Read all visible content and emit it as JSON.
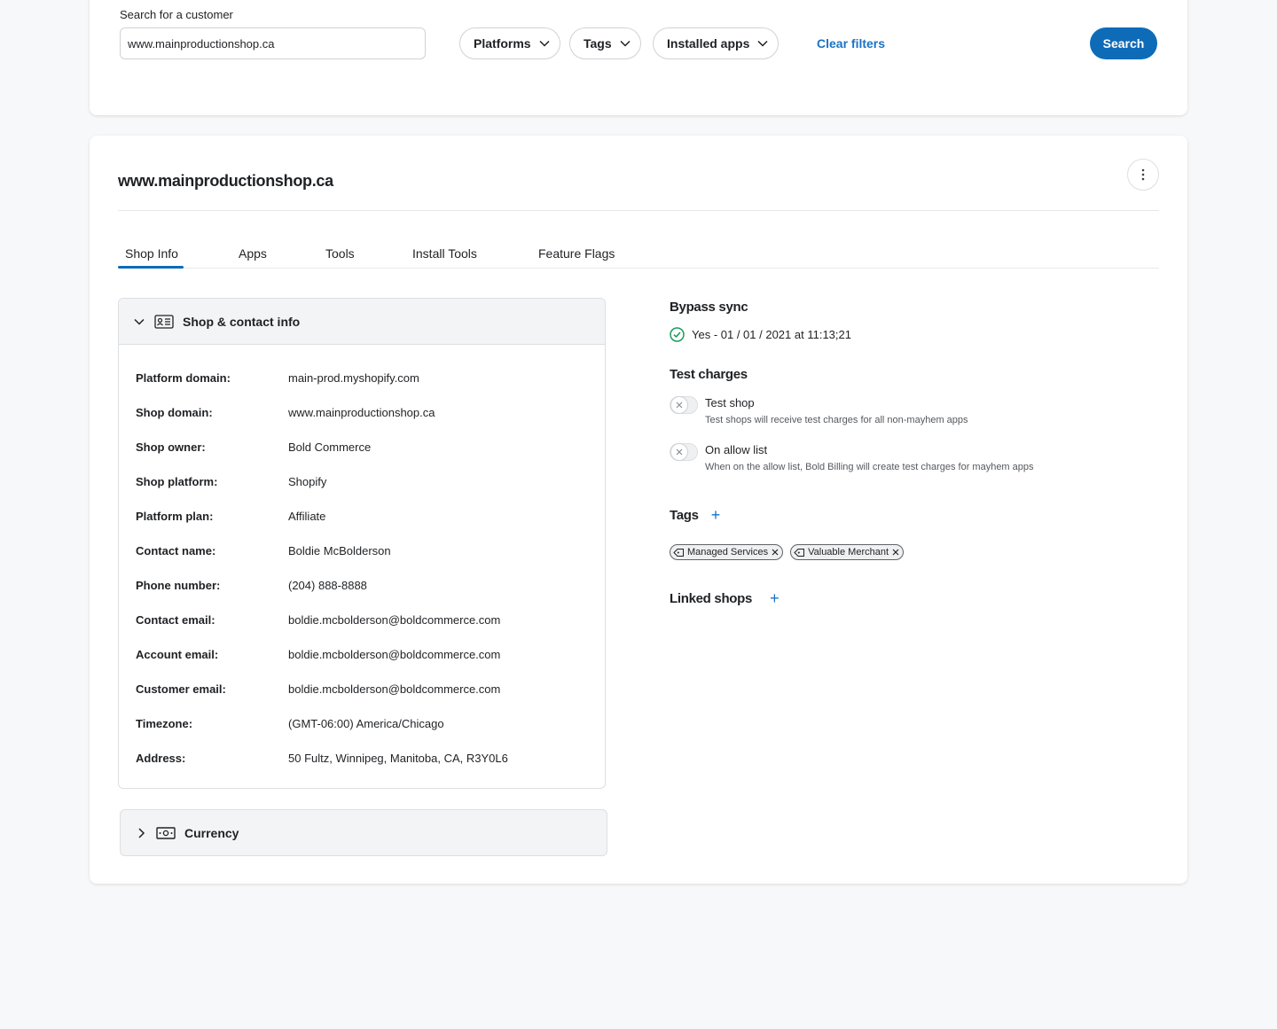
{
  "search": {
    "label": "Search for a customer",
    "value": "www.mainproductionshop.ca",
    "filters": [
      {
        "label": "Platforms"
      },
      {
        "label": "Tags"
      },
      {
        "label": "Installed apps"
      }
    ],
    "clear_label": "Clear filters",
    "button_label": "Search"
  },
  "shop": {
    "title": "www.mainproductionshop.ca",
    "tabs": [
      {
        "label": "Shop Info",
        "active": true
      },
      {
        "label": "Apps"
      },
      {
        "label": "Tools"
      },
      {
        "label": "Install Tools"
      },
      {
        "label": "Feature Flags"
      }
    ],
    "contact_section": {
      "title": "Shop & contact info",
      "icon": "id-card-icon",
      "rows": [
        {
          "label": "Platform domain:",
          "value": "main-prod.myshopify.com"
        },
        {
          "label": "Shop domain:",
          "value": "www.mainproductionshop.ca"
        },
        {
          "label": "Shop owner:",
          "value": "Bold Commerce"
        },
        {
          "label": "Shop platform:",
          "value": "Shopify"
        },
        {
          "label": "Platform plan:",
          "value": "Affiliate"
        },
        {
          "label": "Contact name:",
          "value": "Boldie McBolderson"
        },
        {
          "label": "Phone number:",
          "value": "(204) 888-8888"
        },
        {
          "label": "Contact email:",
          "value": "boldie.mcbolderson@boldcommerce.com"
        },
        {
          "label": "Account email:",
          "value": "boldie.mcbolderson@boldcommerce.com"
        },
        {
          "label": "Customer email:",
          "value": "boldie.mcbolderson@boldcommerce.com"
        },
        {
          "label": "Timezone:",
          "value": "(GMT-06:00) America/Chicago"
        },
        {
          "label": "Address:",
          "value": "50 Fultz, Winnipeg, Manitoba, CA, R3Y0L6"
        }
      ]
    },
    "currency_section": {
      "title": "Currency",
      "icon": "banknote-icon"
    },
    "bypass_sync": {
      "title": "Bypass sync",
      "status": "Yes - 01 / 01 / 2021 at 11:13;21",
      "status_color": "#1a9a5c"
    },
    "test_charges": {
      "title": "Test charges",
      "options": [
        {
          "label": "Test shop",
          "description": "Test shops will receive test charges for all non-mayhem apps",
          "enabled": false
        },
        {
          "label": "On allow list",
          "description": "When on the allow list, Bold Billing will create test charges for mayhem apps",
          "enabled": false
        }
      ]
    },
    "tags": {
      "title": "Tags",
      "items": [
        "Managed Services",
        "Valuable Merchant"
      ]
    },
    "linked_shops": {
      "title": "Linked shops"
    }
  },
  "colors": {
    "accent": "#0e6bb8",
    "link": "#1a73c6",
    "success": "#1a9a5c"
  }
}
